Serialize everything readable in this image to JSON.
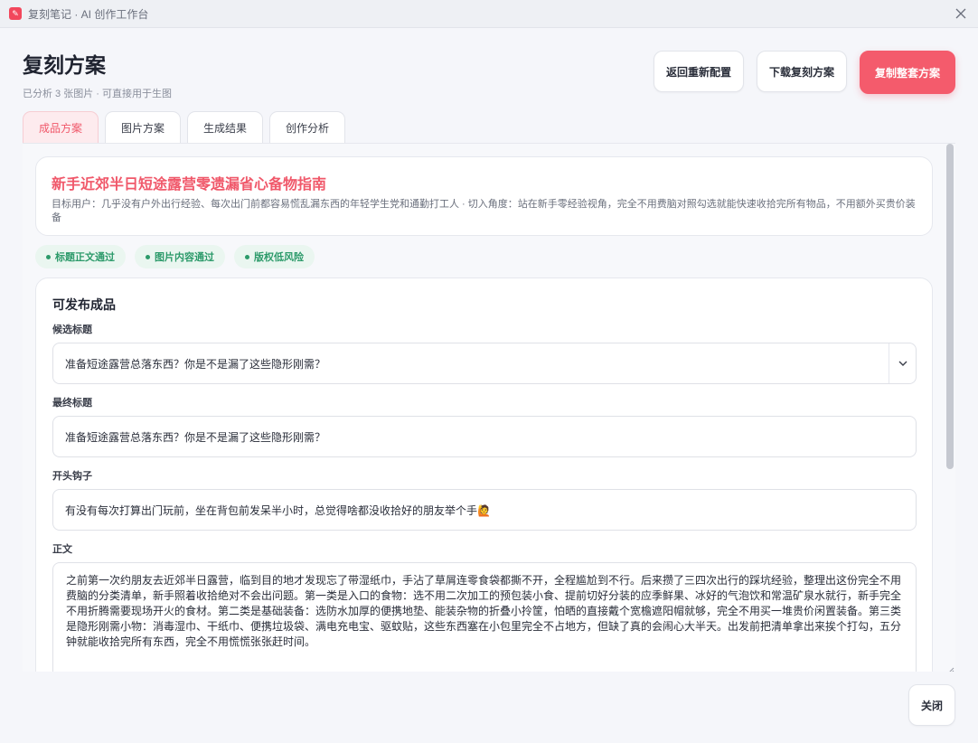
{
  "window": {
    "title": "复刻笔记 · AI 创作工作台"
  },
  "header": {
    "title": "复刻方案",
    "subtitle": "已分析 3 张图片 · 可直接用于生图",
    "buttons": {
      "reconfigure": "返回重新配置",
      "download": "下载复刻方案",
      "copy_all": "复制整套方案"
    }
  },
  "tabs": [
    {
      "label": "成品方案",
      "active": true
    },
    {
      "label": "图片方案",
      "active": false
    },
    {
      "label": "生成结果",
      "active": false
    },
    {
      "label": "创作分析",
      "active": false
    }
  ],
  "plan": {
    "title": "新手近郊半日短途露营零遗漏省心备物指南",
    "meta": "目标用户：几乎没有户外出行经验、每次出门前都容易慌乱漏东西的年轻学生党和通勤打工人   ·   切入角度：站在新手零经验视角，完全不用费脑对照勾选就能快速收拾完所有物品，不用额外买贵价装备"
  },
  "badges": [
    "标题正文通过",
    "图片内容通过",
    "版权低风险"
  ],
  "publish": {
    "section_title": "可发布成品",
    "candidate_title_label": "候选标题",
    "candidate_title_value": "准备短途露营总落东西？你是不是漏了这些隐形刚需？",
    "final_title_label": "最终标题",
    "final_title_value": "准备短途露营总落东西？你是不是漏了这些隐形刚需？",
    "hook_label": "开头钩子",
    "hook_value": "有没有每次打算出门玩前，坐在背包前发呆半小时，总觉得啥都没收拾好的朋友举个手🙋",
    "body_label": "正文",
    "body_value": "之前第一次约朋友去近郊半日露营，临到目的地才发现忘了带湿纸巾，手沾了草屑连零食袋都撕不开，全程尴尬到不行。后来攒了三四次出行的踩坑经验，整理出这份完全不用费脑的分类清单，新手照着收拾绝对不会出问题。第一类是入口的食物：选不用二次加工的预包装小食、提前切好分装的应季鲜果、冰好的气泡饮和常温矿泉水就行，新手完全不用折腾需要现场开火的食材。第二类是基础装备：选防水加厚的便携地垫、能装杂物的折叠小拎筐，怕晒的直接戴个宽檐遮阳帽就够，完全不用买一堆贵价闲置装备。第三类是隐形刚需小物：消毒湿巾、干纸巾、便携垃圾袋、满电充电宝、驱蚊贴，这些东西塞在小包里完全不占地方，但缺了真的会闹心大半天。出发前把清单拿出来挨个打勾，五分钟就能收拾完所有东西，完全不用慌慌张张赶时间。"
  },
  "footer": {
    "close_label": "关闭"
  },
  "colors": {
    "accent": "#f45b6c",
    "success": "#2c9a6a"
  },
  "icons": {
    "app": "app-logo-icon",
    "close": "close-icon",
    "dropdown": "chevron-down-icon"
  }
}
